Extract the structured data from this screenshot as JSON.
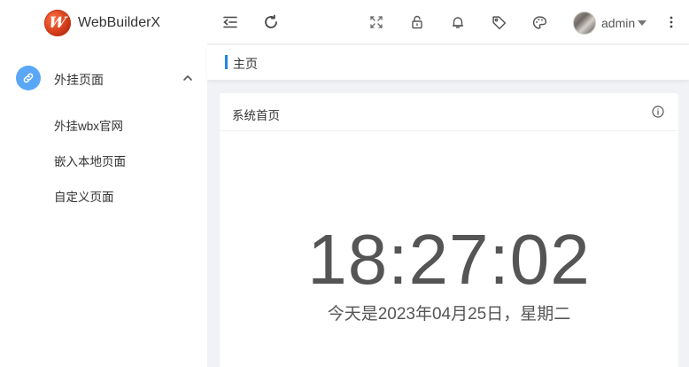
{
  "brand": {
    "title": "WebBuilderX",
    "logo_letter": "W"
  },
  "sidebar": {
    "group": {
      "label": "外挂页面",
      "icon": "link-icon",
      "expanded": true
    },
    "items": [
      {
        "label": "外挂wbx官网"
      },
      {
        "label": "嵌入本地页面"
      },
      {
        "label": "自定义页面"
      }
    ]
  },
  "header": {
    "icons": [
      "menu-fold-icon",
      "refresh-icon",
      "fullscreen-icon",
      "lock-icon",
      "bell-icon",
      "tag-icon",
      "palette-icon",
      "more-icon"
    ],
    "user": {
      "name": "admin"
    }
  },
  "breadcrumb": {
    "current": "主页"
  },
  "card": {
    "title": "系统首页",
    "time": "18:27:02",
    "date_text": "今天是2023年04月25日，星期二"
  },
  "colors": {
    "accent": "#1e88e5",
    "group_icon_bg": "#5aa7f7"
  }
}
